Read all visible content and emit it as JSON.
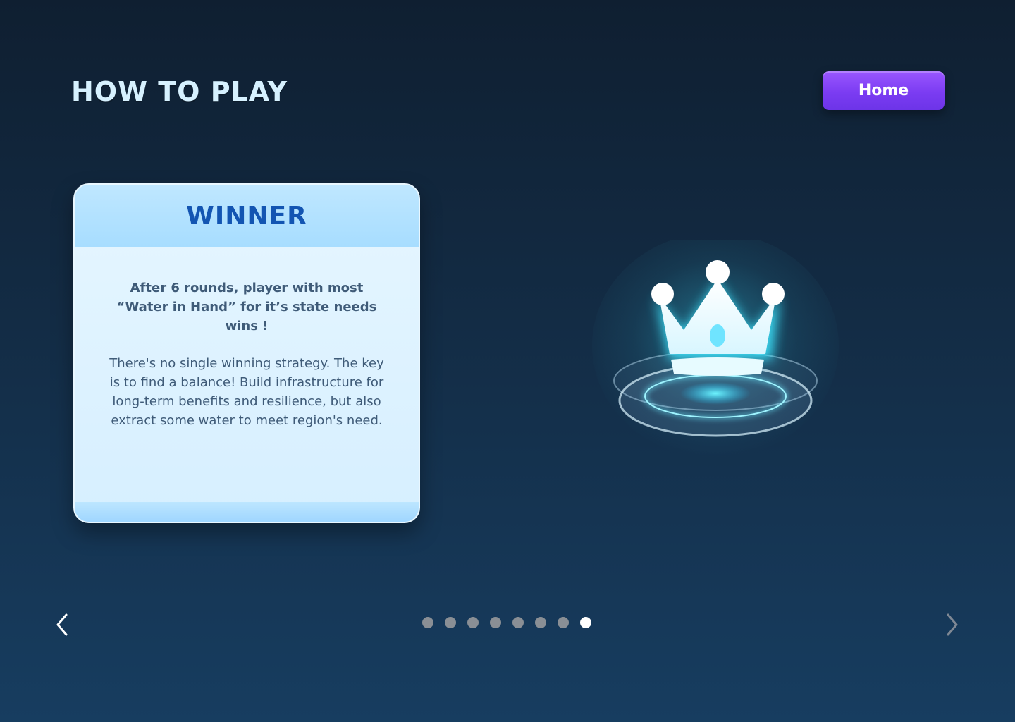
{
  "header": {
    "title": "HOW TO PLAY",
    "home_label": "Home"
  },
  "card": {
    "title": "WINNER",
    "rules": "After 6 rounds, player with most “Water in Hand” for it’s state needs wins !",
    "tip": "There's no single winning strategy. The key is to find a balance! Build infrastructure for long-term benefits and resilience, but also extract some water to meet region's need."
  },
  "illustration": {
    "icon": "crown-icon"
  },
  "pagination": {
    "total": 8,
    "current": 8
  },
  "navigation": {
    "prev_icon": "chevron-left-icon",
    "next_icon": "chevron-right-icon"
  },
  "colors": {
    "accent": "#7b3cf2",
    "card_title": "#1355b2",
    "glow": "#3ee6ff"
  }
}
